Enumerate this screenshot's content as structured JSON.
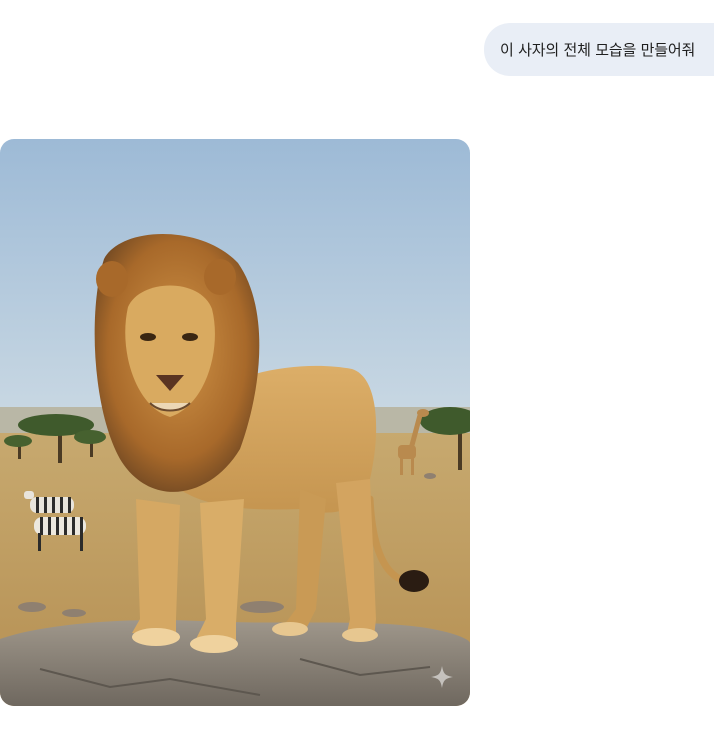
{
  "conversation": {
    "user_message": "이 사자의 전체 모습을 만들어줘",
    "response_image": {
      "subject": "lion",
      "alt": "사자의 전체 모습"
    }
  },
  "colors": {
    "user_bubble_bg": "#e9eef6",
    "page_bg": "#ffffff",
    "sky": "#a9c4dc",
    "savanna": "#c9a86a",
    "lion_body": "#d2a25a",
    "mane": "#b9782e",
    "rock": "#8c8479"
  },
  "icons": {
    "sparkle": "gemini-sparkle-icon"
  }
}
